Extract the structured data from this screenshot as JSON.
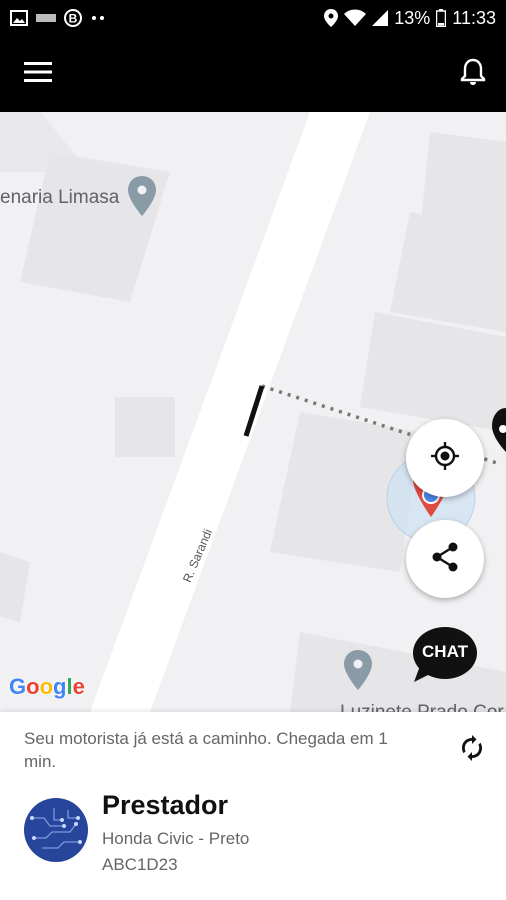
{
  "status_bar": {
    "battery": "13%",
    "time": "11:33",
    "icons": [
      "image-icon",
      "news-icon",
      "b-icon",
      "dots-icon",
      "location-icon",
      "wifi-icon",
      "signal-icon",
      "battery-icon"
    ]
  },
  "app_bar": {
    "menu_icon": "hamburger-menu-icon",
    "notification_icon": "bell-icon"
  },
  "map": {
    "place_label_1": "enaria Limasa",
    "place_label_2": "Luzinete Prado Cor",
    "street_label": "R. Sarandi",
    "google_logo": [
      "G",
      "o",
      "o",
      "g",
      "l",
      "e"
    ],
    "google_colors": [
      "#4285F4",
      "#EA4335",
      "#FBBC05",
      "#4285F4",
      "#34A853",
      "#EA4335"
    ],
    "chat_label": "CHAT",
    "buttons": [
      "my-location-icon",
      "share-icon"
    ]
  },
  "panel": {
    "status_message": "Seu motorista já está a caminho. Chegada em 1 min.",
    "provider_name": "Prestador",
    "vehicle": "Honda Civic - Preto",
    "plate": "ABC1D23",
    "refresh_icon": "refresh-icon"
  }
}
